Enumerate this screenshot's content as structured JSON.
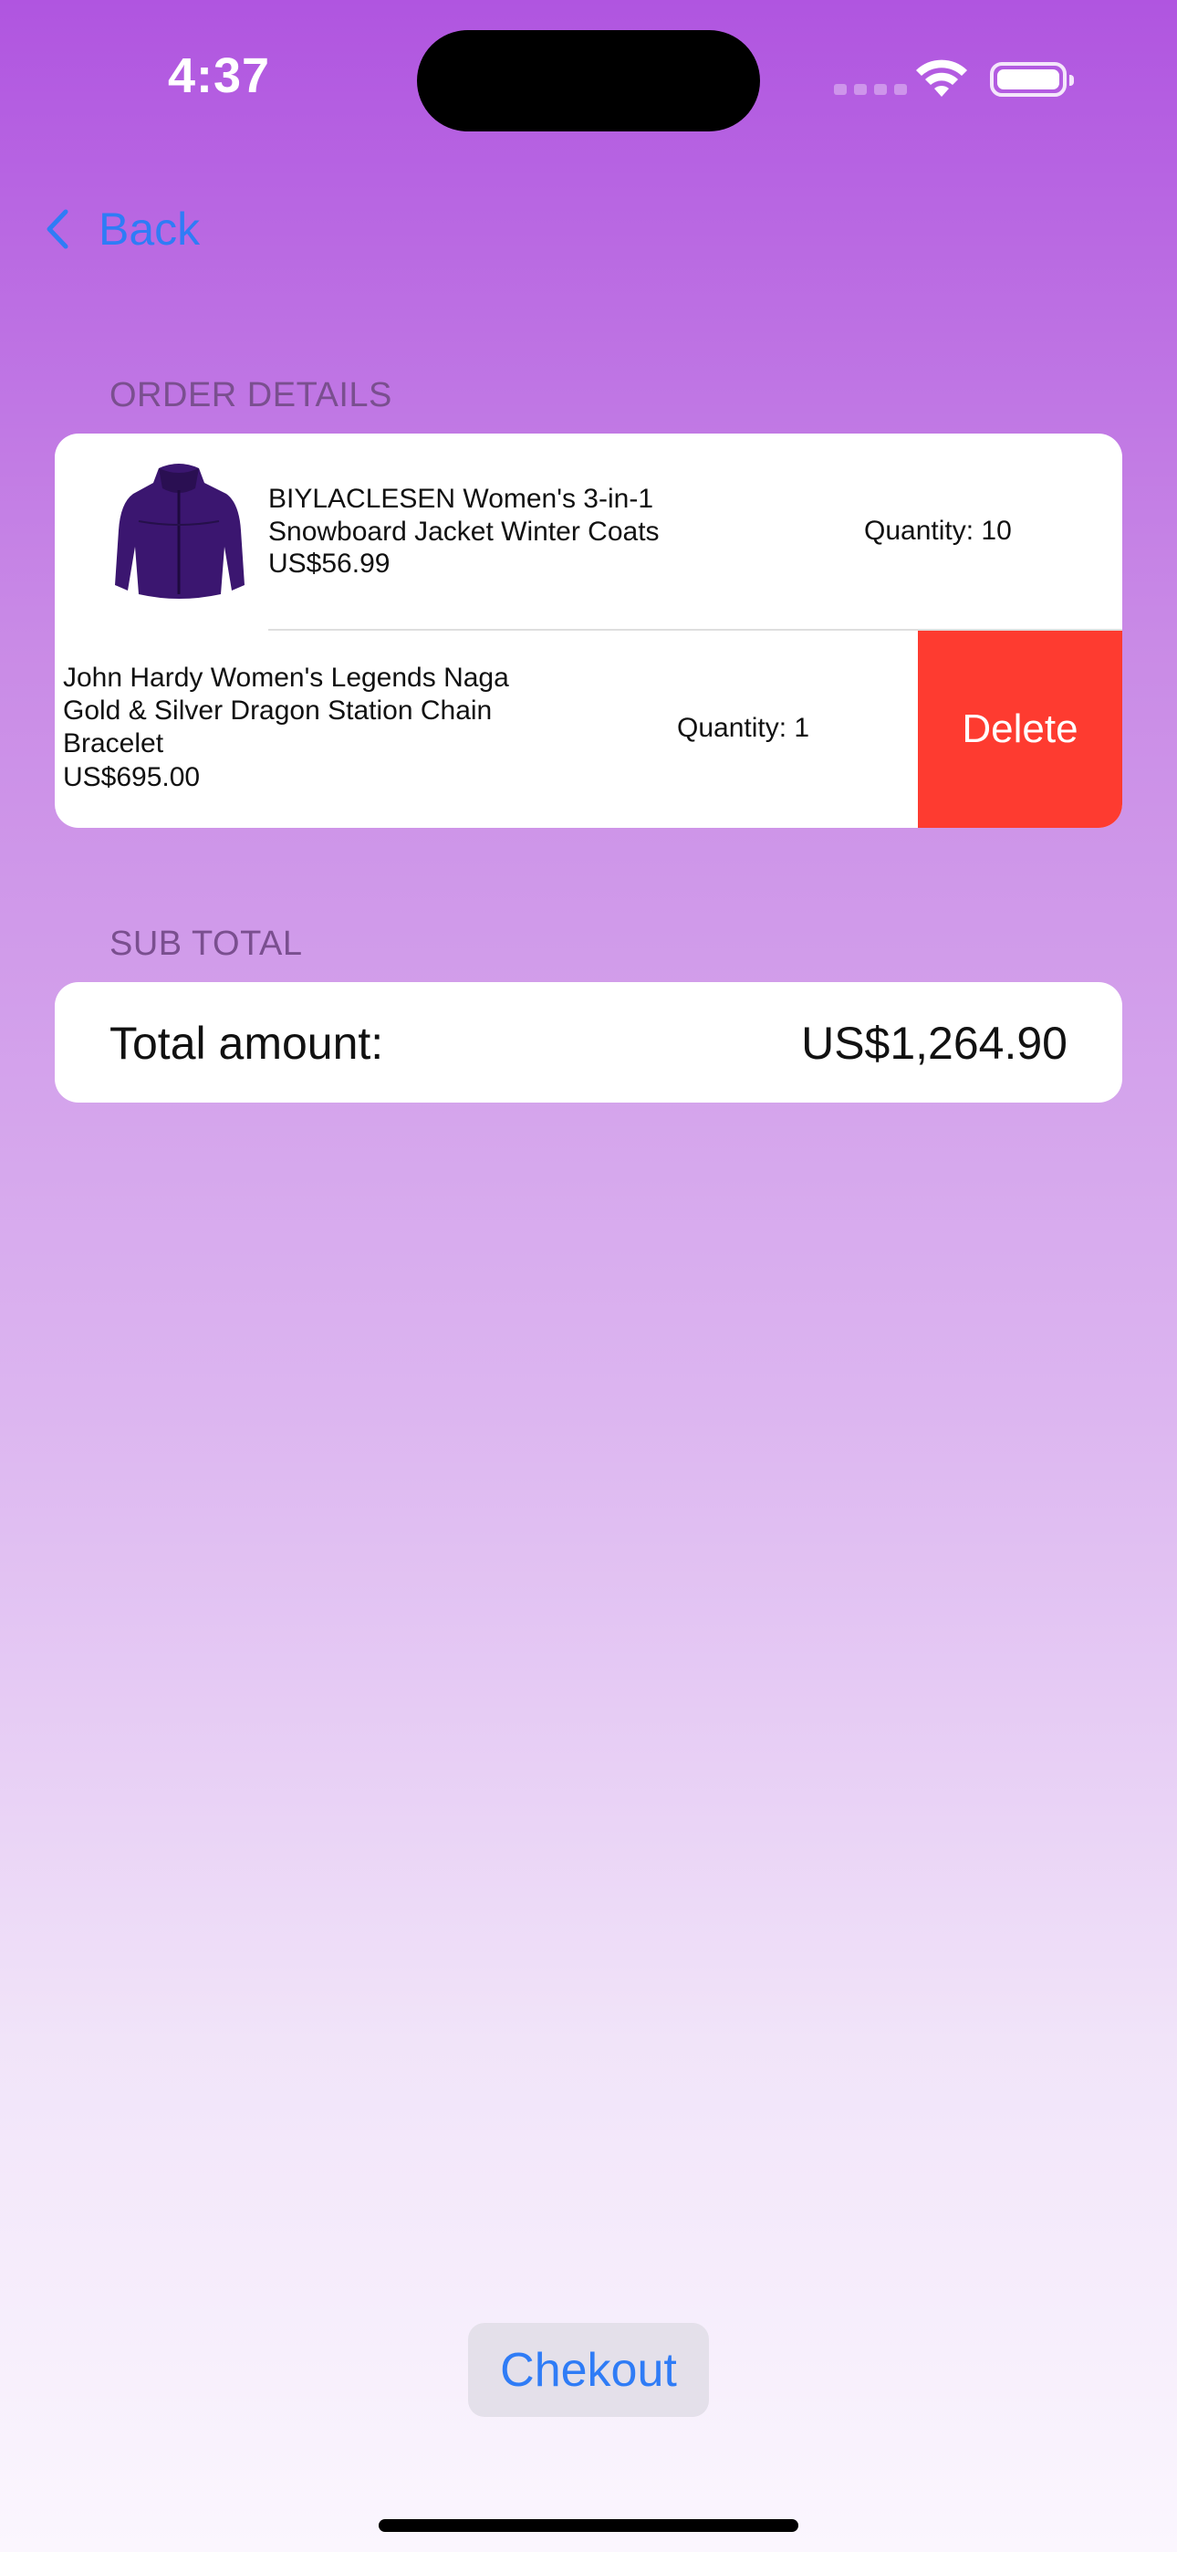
{
  "status_bar": {
    "time": "4:37"
  },
  "nav": {
    "back_label": "Back"
  },
  "order_details": {
    "header": "ORDER DETAILS",
    "items": [
      {
        "title": "BIYLACLESEN Women's 3-in-1 Snowboard Jacket Winter Coats",
        "price": "US$56.99",
        "quantity": "Quantity: 10",
        "image": "purple-jacket-thumbnail"
      },
      {
        "title": "John Hardy Women's Legends Naga Gold & Silver Dragon Station Chain Bracelet",
        "price": "US$695.00",
        "quantity": "Quantity: 1",
        "delete_label": "Delete"
      }
    ]
  },
  "sub_total": {
    "header": "SUB TOTAL",
    "label": "Total amount:",
    "value": "US$1,264.90"
  },
  "checkout_label": "Chekout",
  "colors": {
    "accent": "#2f7cf6",
    "delete": "#fe3b30",
    "gradient_top": "#b055e0",
    "gradient_bottom": "#fbf6fe"
  }
}
